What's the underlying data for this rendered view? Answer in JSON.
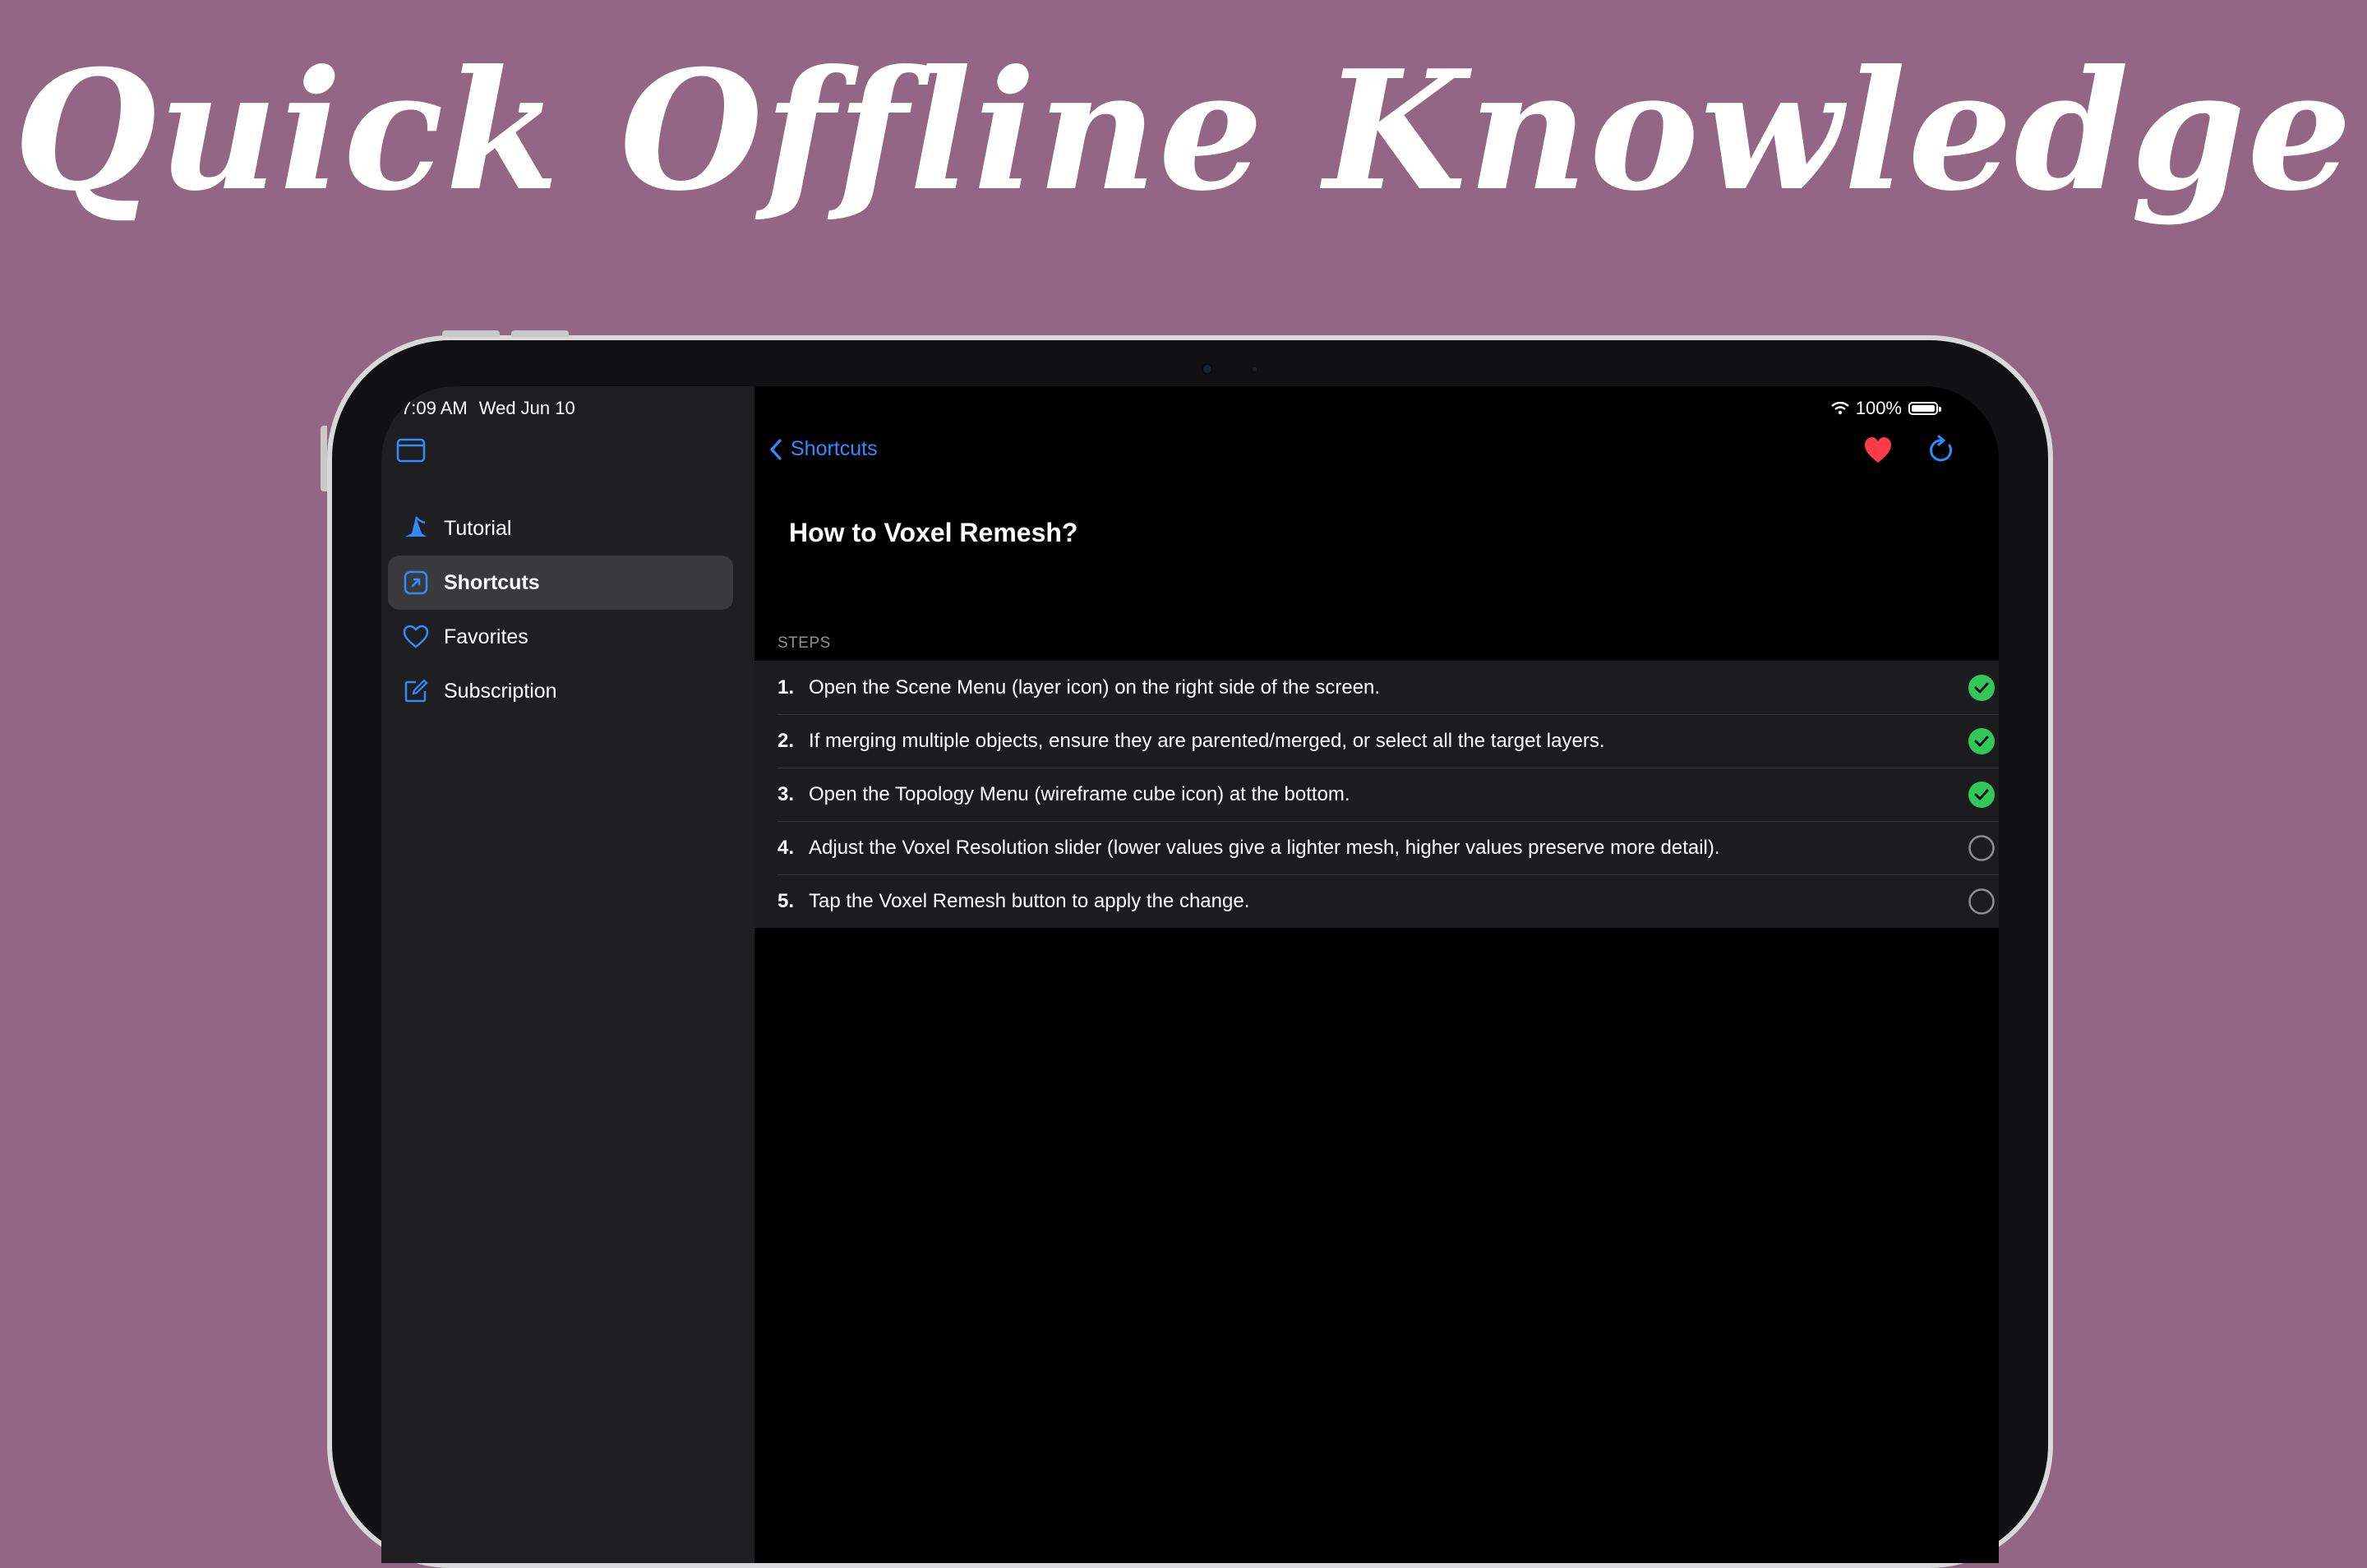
{
  "headline": "Quick Offline Knowledge",
  "status_bar": {
    "time": "7:09 AM",
    "date": "Wed Jun 10",
    "battery": "100%"
  },
  "sidebar": {
    "items": [
      {
        "label": "Tutorial",
        "icon": "wizard-hat-icon",
        "active": false
      },
      {
        "label": "Shortcuts",
        "icon": "arrow-up-right-square-icon",
        "active": true
      },
      {
        "label": "Favorites",
        "icon": "heart-outline-icon",
        "active": false
      },
      {
        "label": "Subscription",
        "icon": "square-pencil-icon",
        "active": false
      }
    ]
  },
  "main": {
    "back_label": "Shortcuts",
    "title": "How to Voxel Remesh?",
    "section_label": "STEPS",
    "steps": [
      {
        "num": "1.",
        "text": "Open the Scene Menu (layer icon) on the right side of the screen.",
        "done": true
      },
      {
        "num": "2.",
        "text": "If merging multiple objects, ensure they are parented/merged, or select all the target layers.",
        "done": true
      },
      {
        "num": "3.",
        "text": "Open the Topology Menu (wireframe cube icon) at the bottom.",
        "done": true
      },
      {
        "num": "4.",
        "text": "Adjust the Voxel Resolution slider (lower values give a lighter mesh, higher values preserve more detail).",
        "done": false
      },
      {
        "num": "5.",
        "text": "Tap the Voxel Remesh button to apply the change.",
        "done": false
      }
    ]
  },
  "colors": {
    "background": "#936683",
    "accent": "#2f8cff",
    "done": "#32c759",
    "favorite": "#ff3b4a"
  }
}
